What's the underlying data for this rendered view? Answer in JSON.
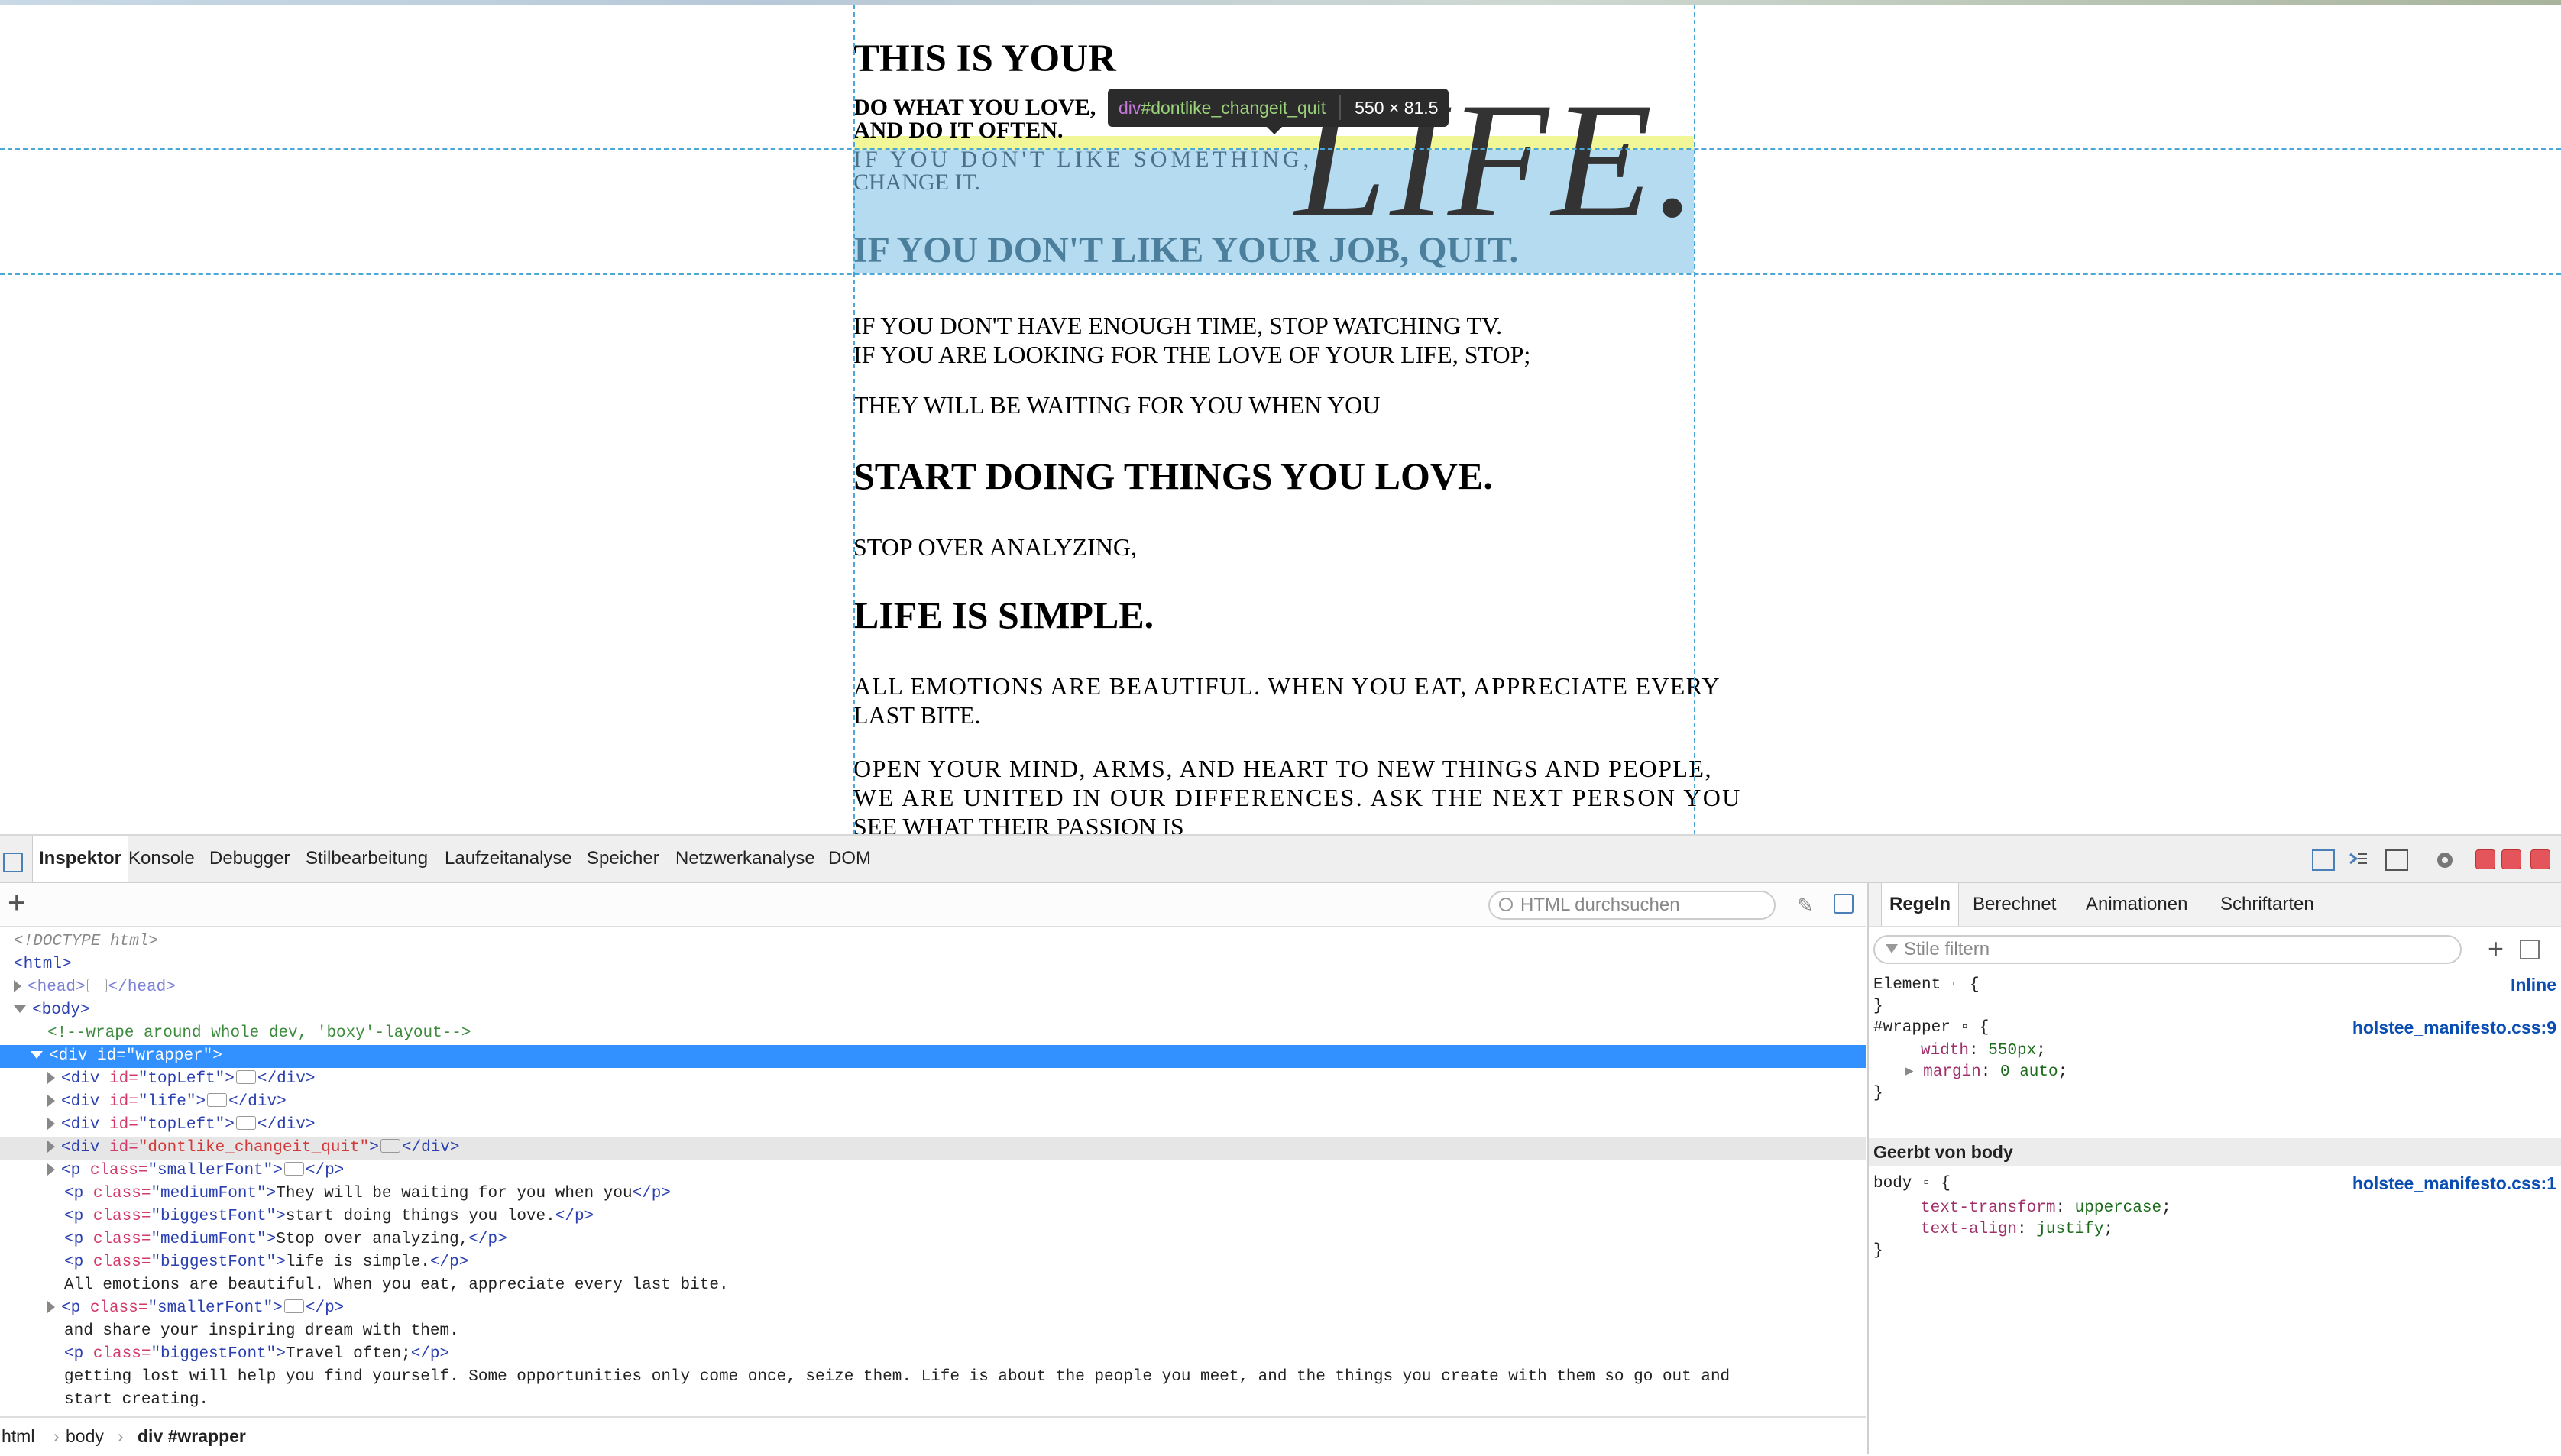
{
  "page": {
    "line1": "THIS IS YOUR",
    "line2a": "DO WHAT YOU LOVE,",
    "line2b": "AND DO IT OFTEN.",
    "life_word": "LIFE.",
    "line3a": "IF YOU DON'T LIKE SOMETHING,",
    "line3b": "CHANGE IT.",
    "line4": "IF YOU DON'T LIKE YOUR JOB, QUIT.",
    "line5": "IF YOU DON'T HAVE ENOUGH TIME, STOP WATCHING TV.",
    "line6": "IF YOU ARE LOOKING FOR THE LOVE OF YOUR LIFE, STOP;",
    "line7": "THEY WILL BE WAITING FOR YOU WHEN YOU",
    "line8": "START DOING THINGS YOU LOVE.",
    "line9": "STOP OVER ANALYZING,",
    "line10": "LIFE IS SIMPLE.",
    "line11a": "ALL EMOTIONS ARE BEAUTIFUL. WHEN YOU EAT, APPRECIATE EVERY",
    "line11b": "LAST BITE.",
    "line12a": "OPEN YOUR MIND, ARMS, AND HEART TO NEW THINGS AND PEOPLE,",
    "line12b": "WE ARE UNITED IN OUR DIFFERENCES. ASK THE NEXT PERSON YOU",
    "line12c": "SEE WHAT THEIR PASSION IS"
  },
  "tooltip": {
    "tag": "div",
    "id": "#dontlike_changeit_quit",
    "size": "550 × 81.5"
  },
  "devtools": {
    "tabs": [
      "Inspektor",
      "Konsole",
      "Debugger",
      "Stilbearbeitung",
      "Laufzeitanalyse",
      "Speicher",
      "Netzwerkanalyse",
      "DOM"
    ],
    "search_placeholder": "HTML durchsuchen",
    "tree": {
      "doctype": "<!DOCTYPE html>",
      "html_open": "<html>",
      "head": "<head>",
      "head_close": "</head>",
      "body_open": "<body>",
      "comment": "<!--wrape around whole dev, 'boxy'-layout-->",
      "wrapper_tag": "<div ",
      "wrapper_attr": "id=",
      "wrapper_val": "\"wrapper\"",
      "wrapper_end": ">",
      "rows": [
        {
          "attr": "id=",
          "val": "\"topLeft\""
        },
        {
          "attr": "id=",
          "val": "\"life\""
        },
        {
          "attr": "id=",
          "val": "\"topLeft\""
        },
        {
          "attr": "id=",
          "val": "\"dontlike_changeit_quit\""
        }
      ],
      "p_smaller1": "\"smallerFont\"",
      "p_medium1_val": "\"mediumFont\"",
      "p_medium1_text": "They will be waiting for you when you",
      "p_biggest1_val": "\"biggestFont\"",
      "p_biggest1_text": "start doing things you love.",
      "p_medium2_val": "\"mediumFont\"",
      "p_medium2_text": "Stop over analyzing,",
      "p_biggest2_val": "\"biggestFont\"",
      "p_biggest2_text": "life is simple.",
      "text1": "All emotions are beautiful. When you eat, appreciate every last bite.",
      "p_smaller2": "\"smallerFont\"",
      "text2": "and share your inspiring dream with them.",
      "p_biggest3_val": "\"biggestFont\"",
      "p_biggest3_text": "Travel often;",
      "text3": "getting lost will help you find yourself. Some opportunities only come once, seize them. Life is about the people you meet, and the things you create with them so go out and",
      "text4": "start creating."
    },
    "breadcrumb": [
      "html",
      "body",
      "div #wrapper"
    ],
    "right_tabs": [
      "Regeln",
      "Berechnet",
      "Animationen",
      "Schriftarten"
    ],
    "filter_placeholder": "Stile filtern",
    "rules": {
      "element_sel": "Element",
      "element_src": "Inline",
      "wrapper_sel": "#wrapper",
      "wrapper_src": "holstee_manifesto.css:9",
      "wrapper_p1": "width",
      "wrapper_v1": "550px",
      "wrapper_p2": "margin",
      "wrapper_v2": "0 auto",
      "inherited_label": "Geerbt von body",
      "body_sel": "body",
      "body_src": "holstee_manifesto.css:1",
      "body_p1": "text-transform",
      "body_v1": "uppercase",
      "body_p2": "text-align",
      "body_v2": "justify"
    }
  }
}
